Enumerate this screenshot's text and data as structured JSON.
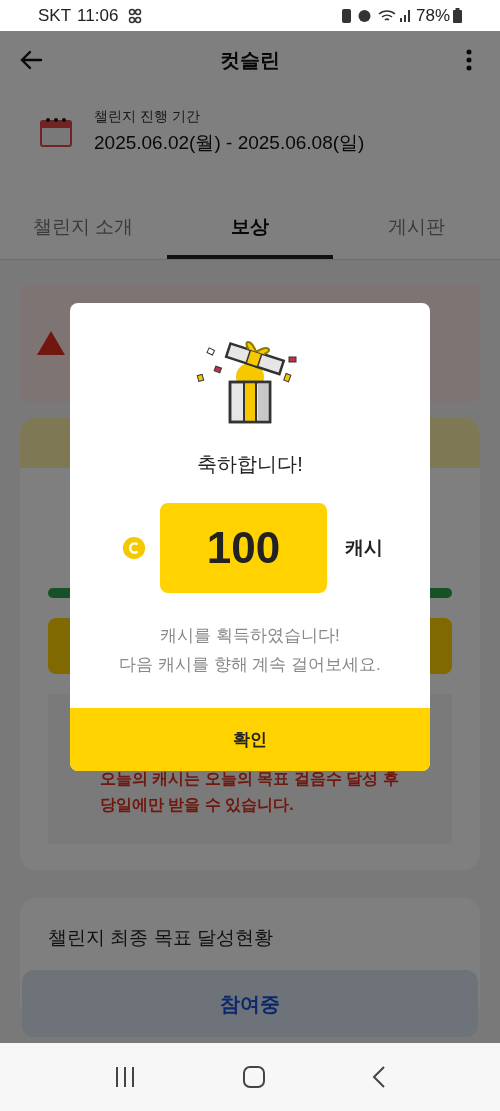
{
  "status_bar": {
    "carrier": "SKT",
    "time": "11:06",
    "battery": "78%"
  },
  "header": {
    "title": "컷슬린"
  },
  "period": {
    "label": "챌린지 진행 기간",
    "value": "2025.06.02(월) - 2025.06.08(일)"
  },
  "tabs": [
    {
      "label": "챌린지 소개",
      "selected": false
    },
    {
      "label": "보상",
      "selected": true
    },
    {
      "label": "게시판",
      "selected": false
    }
  ],
  "today_card": {
    "progress": {
      "level": 1
    },
    "notice": "오늘의 캐시는 오늘의 목표 걸음수 달성 후\n당일에만 받을 수 있습니다."
  },
  "final_goal": {
    "title": "챌린지 최종 목표 달성현황"
  },
  "bottom_button": {
    "label": "참여중"
  },
  "dialog": {
    "title": "축하합니다!",
    "amount": "100",
    "unit": "캐시",
    "message": "캐시를 획득하였습니다!\n다음 캐시를 향해 계속 걸어보세요.",
    "confirm": "확인"
  }
}
